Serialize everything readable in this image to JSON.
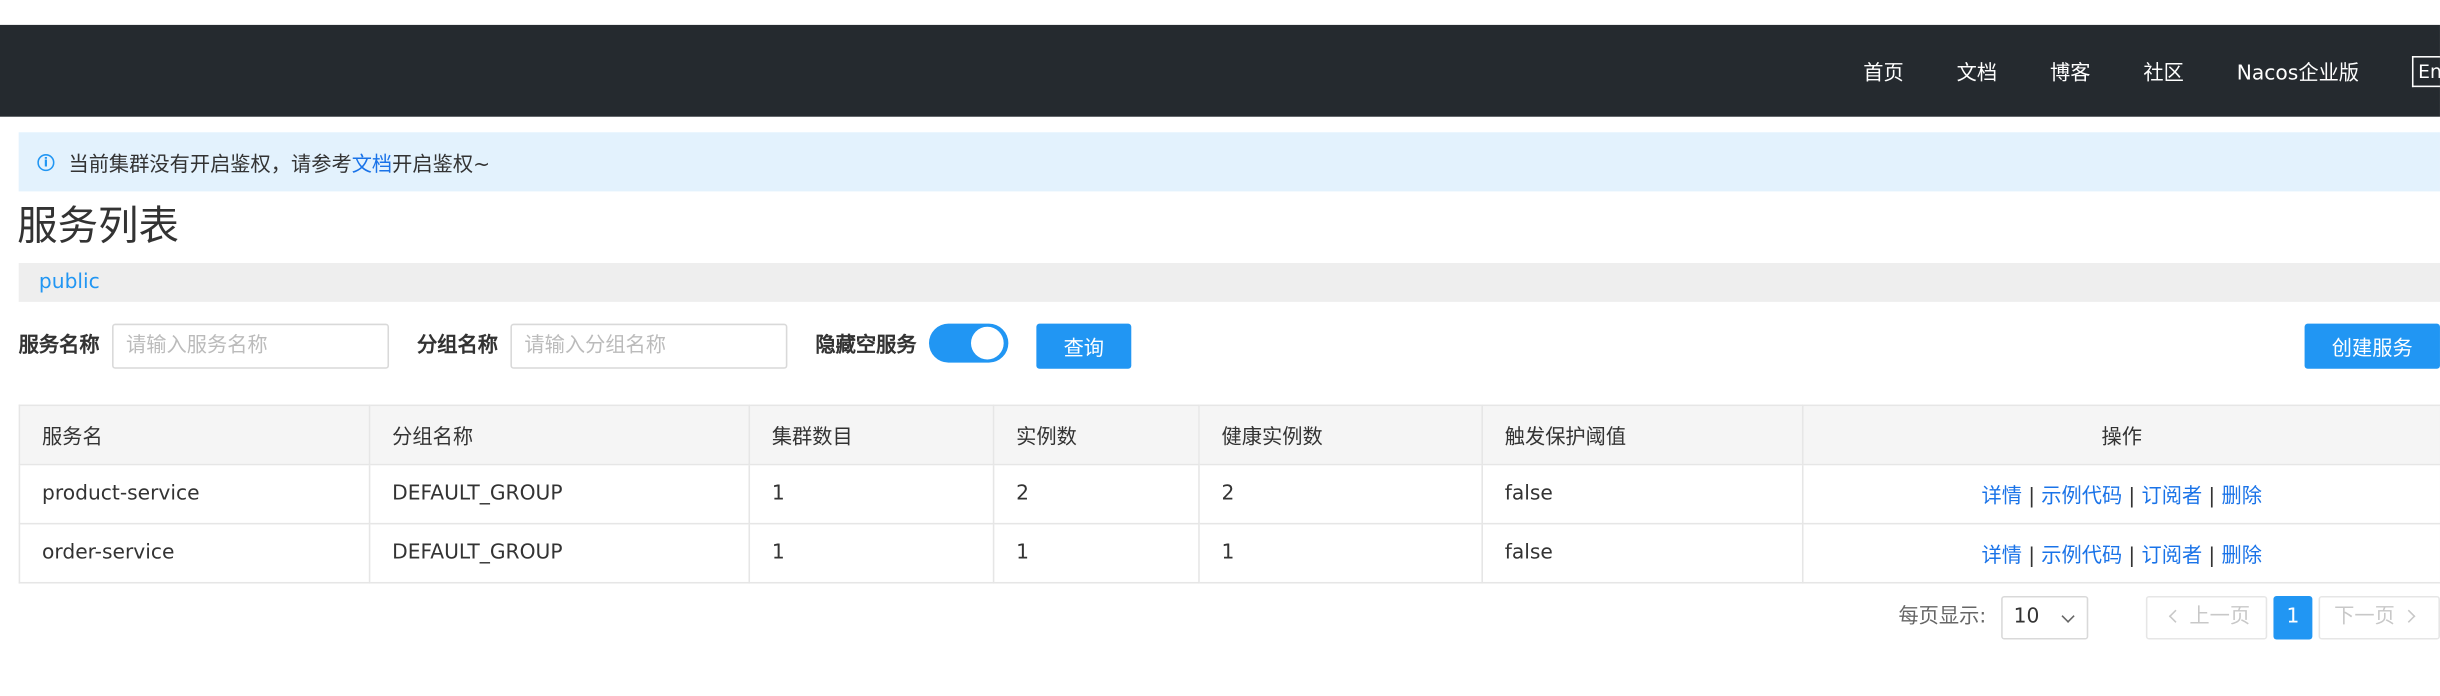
{
  "header": {
    "nav": [
      "首页",
      "文档",
      "博客",
      "社区",
      "Nacos企业版"
    ],
    "lang": "En"
  },
  "notice": {
    "text_before": "当前集群没有开启鉴权，请参考",
    "link": "文档",
    "text_after": "开启鉴权~"
  },
  "page_title": "服务列表",
  "namespace": "public",
  "search": {
    "service_name_label": "服务名称",
    "service_name_placeholder": "请输入服务名称",
    "service_name_value": "",
    "group_name_label": "分组名称",
    "group_name_placeholder": "请输入分组名称",
    "group_name_value": "",
    "hide_empty_label": "隐藏空服务",
    "hide_empty_on": true,
    "query_button": "查询",
    "create_button": "创建服务"
  },
  "table": {
    "headers": [
      "服务名",
      "分组名称",
      "集群数目",
      "实例数",
      "健康实例数",
      "触发保护阈值",
      "操作"
    ],
    "rows": [
      {
        "name": "product-service",
        "group": "DEFAULT_GROUP",
        "clusters": "1",
        "instances": "2",
        "healthy": "2",
        "threshold": "false"
      },
      {
        "name": "order-service",
        "group": "DEFAULT_GROUP",
        "clusters": "1",
        "instances": "1",
        "healthy": "1",
        "threshold": "false"
      }
    ],
    "actions": [
      "详情",
      "示例代码",
      "订阅者",
      "删除"
    ],
    "action_sep": "|"
  },
  "pagination": {
    "page_size_label": "每页显示:",
    "page_size": "10",
    "prev": "上一页",
    "next": "下一页",
    "current_page": "1"
  },
  "colors": {
    "header_bg": "#252a2f",
    "accent": "#2196f3",
    "notice_bg": "#e3f2fd"
  }
}
